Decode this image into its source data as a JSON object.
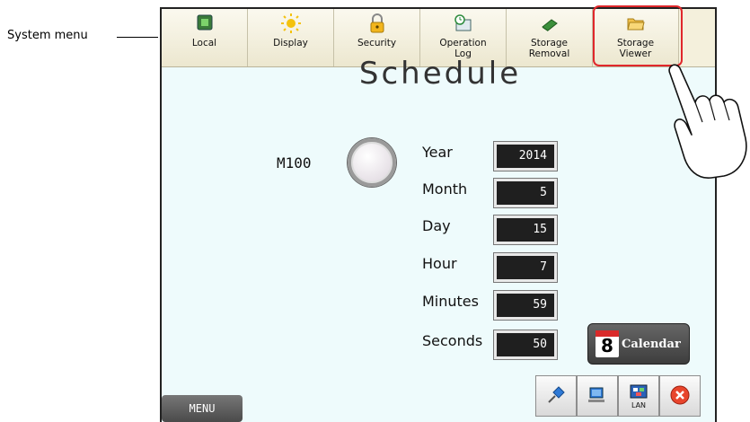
{
  "callout": {
    "label": "System menu"
  },
  "system_menu": {
    "items": [
      {
        "label": "Local",
        "icon": "local-icon"
      },
      {
        "label": "Display",
        "icon": "sun-icon"
      },
      {
        "label": "Security",
        "icon": "padlock-icon"
      },
      {
        "label": "Operation\nLog",
        "icon": "clock-log-icon"
      },
      {
        "label": "Storage\nRemoval",
        "icon": "storage-removal-icon"
      },
      {
        "label": "Storage\nViewer",
        "icon": "folder-icon"
      }
    ],
    "selected": "Storage Viewer",
    "highlight_color": "#e0272b"
  },
  "screen": {
    "title": "Schedule",
    "lamp_label": "M100",
    "fields": [
      {
        "label": "Year",
        "value": "2014"
      },
      {
        "label": "Month",
        "value": "5"
      },
      {
        "label": "Day",
        "value": "15"
      },
      {
        "label": "Hour",
        "value": "7"
      },
      {
        "label": "Minutes",
        "value": "59"
      },
      {
        "label": "Seconds",
        "value": "50"
      }
    ],
    "calendar_button": {
      "day": "8",
      "label": "Calendar"
    },
    "menu_button": "MENU",
    "tray": {
      "pin_icon": "pushpin-icon",
      "network_icon": "network-computer-icon",
      "lan_label": "LAN",
      "close_icon": "close-icon"
    },
    "background": "#eefbfc"
  }
}
